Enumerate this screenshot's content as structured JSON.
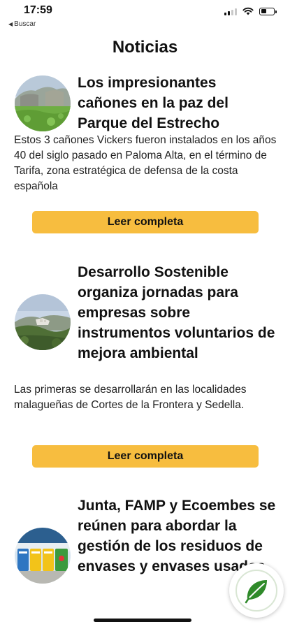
{
  "status_bar": {
    "time": "17:59",
    "back_label": "Buscar"
  },
  "header": {
    "title": "Noticias"
  },
  "articles": [
    {
      "title": "Los impresionantes cañones en la paz del Parque del Estrecho",
      "summary": "Estos 3 cañones Vickers fueron instalados en los años 40 del siglo pasado en Paloma Alta, en el término de Tarifa, zona estratégica de defensa de la costa española",
      "button_label": "Leer completa",
      "thumb_icon": "cannon-landscape-thumbnail"
    },
    {
      "title": "Desarrollo Sostenible organiza jornadas para empresas sobre instrumentos voluntarios de mejora ambiental",
      "summary": "Las primeras se desarrollarán en las localidades malagueñas de Cortes de la Frontera y Sedella.",
      "button_label": "Leer completa",
      "thumb_icon": "mountain-village-thumbnail"
    },
    {
      "title": "Junta, FAMP y Ecoembes se reúnen para abordar la gestión de los residuos de envases y envases usados",
      "summary": "",
      "button_label": "",
      "thumb_icon": "recycling-bins-thumbnail"
    }
  ],
  "colors": {
    "accent_button": "#f7bd3f",
    "text": "#111111",
    "leaf_green": "#2f8a2a"
  },
  "fab": {
    "icon": "green-leaf-logo-icon"
  }
}
